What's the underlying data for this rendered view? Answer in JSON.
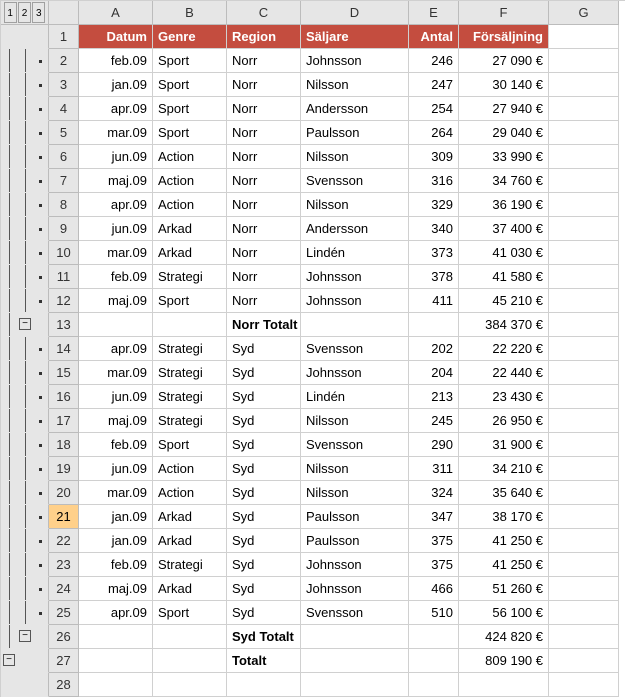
{
  "outline_levels": [
    "1",
    "2",
    "3"
  ],
  "columns": [
    "A",
    "B",
    "C",
    "D",
    "E",
    "F",
    "G"
  ],
  "headers": [
    "Datum",
    "Genre",
    "Region",
    "Säljare",
    "Antal",
    "Försäljning"
  ],
  "rows": [
    {
      "n": 1,
      "header": true
    },
    {
      "n": 2,
      "datum": "feb.09",
      "genre": "Sport",
      "region": "Norr",
      "saljare": "Johnsson",
      "antal": "246",
      "fors": "27 090 €",
      "dot": true,
      "l1": true,
      "l2": true
    },
    {
      "n": 3,
      "datum": "jan.09",
      "genre": "Sport",
      "region": "Norr",
      "saljare": "Nilsson",
      "antal": "247",
      "fors": "30 140 €",
      "dot": true,
      "l1": true,
      "l2": true
    },
    {
      "n": 4,
      "datum": "apr.09",
      "genre": "Sport",
      "region": "Norr",
      "saljare": "Andersson",
      "antal": "254",
      "fors": "27 940 €",
      "dot": true,
      "l1": true,
      "l2": true
    },
    {
      "n": 5,
      "datum": "mar.09",
      "genre": "Sport",
      "region": "Norr",
      "saljare": "Paulsson",
      "antal": "264",
      "fors": "29 040 €",
      "dot": true,
      "l1": true,
      "l2": true
    },
    {
      "n": 6,
      "datum": "jun.09",
      "genre": "Action",
      "region": "Norr",
      "saljare": "Nilsson",
      "antal": "309",
      "fors": "33 990 €",
      "dot": true,
      "l1": true,
      "l2": true
    },
    {
      "n": 7,
      "datum": "maj.09",
      "genre": "Action",
      "region": "Norr",
      "saljare": "Svensson",
      "antal": "316",
      "fors": "34 760 €",
      "dot": true,
      "l1": true,
      "l2": true
    },
    {
      "n": 8,
      "datum": "apr.09",
      "genre": "Action",
      "region": "Norr",
      "saljare": "Nilsson",
      "antal": "329",
      "fors": "36 190 €",
      "dot": true,
      "l1": true,
      "l2": true
    },
    {
      "n": 9,
      "datum": "jun.09",
      "genre": "Arkad",
      "region": "Norr",
      "saljare": "Andersson",
      "antal": "340",
      "fors": "37 400 €",
      "dot": true,
      "l1": true,
      "l2": true
    },
    {
      "n": 10,
      "datum": "mar.09",
      "genre": "Arkad",
      "region": "Norr",
      "saljare": "Lindén",
      "antal": "373",
      "fors": "41 030 €",
      "dot": true,
      "l1": true,
      "l2": true
    },
    {
      "n": 11,
      "datum": "feb.09",
      "genre": "Strategi",
      "region": "Norr",
      "saljare": "Johnsson",
      "antal": "378",
      "fors": "41 580 €",
      "dot": true,
      "l1": true,
      "l2": true
    },
    {
      "n": 12,
      "datum": "maj.09",
      "genre": "Sport",
      "region": "Norr",
      "saljare": "Johnsson",
      "antal": "411",
      "fors": "45 210 €",
      "dot": true,
      "l1": true,
      "l2": true
    },
    {
      "n": 13,
      "subtotal": "Norr Totalt",
      "fors": "384 370 €",
      "minus2": true,
      "l1": true
    },
    {
      "n": 14,
      "datum": "apr.09",
      "genre": "Strategi",
      "region": "Syd",
      "saljare": "Svensson",
      "antal": "202",
      "fors": "22 220 €",
      "dot": true,
      "l1": true,
      "l2": true
    },
    {
      "n": 15,
      "datum": "mar.09",
      "genre": "Strategi",
      "region": "Syd",
      "saljare": "Johnsson",
      "antal": "204",
      "fors": "22 440 €",
      "dot": true,
      "l1": true,
      "l2": true
    },
    {
      "n": 16,
      "datum": "jun.09",
      "genre": "Strategi",
      "region": "Syd",
      "saljare": "Lindén",
      "antal": "213",
      "fors": "23 430 €",
      "dot": true,
      "l1": true,
      "l2": true
    },
    {
      "n": 17,
      "datum": "maj.09",
      "genre": "Strategi",
      "region": "Syd",
      "saljare": "Nilsson",
      "antal": "245",
      "fors": "26 950 €",
      "dot": true,
      "l1": true,
      "l2": true
    },
    {
      "n": 18,
      "datum": "feb.09",
      "genre": "Sport",
      "region": "Syd",
      "saljare": "Svensson",
      "antal": "290",
      "fors": "31 900 €",
      "dot": true,
      "l1": true,
      "l2": true
    },
    {
      "n": 19,
      "datum": "jun.09",
      "genre": "Action",
      "region": "Syd",
      "saljare": "Nilsson",
      "antal": "311",
      "fors": "34 210 €",
      "dot": true,
      "l1": true,
      "l2": true
    },
    {
      "n": 20,
      "datum": "mar.09",
      "genre": "Action",
      "region": "Syd",
      "saljare": "Nilsson",
      "antal": "324",
      "fors": "35 640 €",
      "dot": true,
      "l1": true,
      "l2": true
    },
    {
      "n": 21,
      "datum": "jan.09",
      "genre": "Arkad",
      "region": "Syd",
      "saljare": "Paulsson",
      "antal": "347",
      "fors": "38 170 €",
      "dot": true,
      "l1": true,
      "l2": true,
      "sel": true
    },
    {
      "n": 22,
      "datum": "jan.09",
      "genre": "Arkad",
      "region": "Syd",
      "saljare": "Paulsson",
      "antal": "375",
      "fors": "41 250 €",
      "dot": true,
      "l1": true,
      "l2": true
    },
    {
      "n": 23,
      "datum": "feb.09",
      "genre": "Strategi",
      "region": "Syd",
      "saljare": "Johnsson",
      "antal": "375",
      "fors": "41 250 €",
      "dot": true,
      "l1": true,
      "l2": true
    },
    {
      "n": 24,
      "datum": "maj.09",
      "genre": "Arkad",
      "region": "Syd",
      "saljare": "Johnsson",
      "antal": "466",
      "fors": "51 260 €",
      "dot": true,
      "l1": true,
      "l2": true
    },
    {
      "n": 25,
      "datum": "apr.09",
      "genre": "Sport",
      "region": "Syd",
      "saljare": "Svensson",
      "antal": "510",
      "fors": "56 100 €",
      "dot": true,
      "l1": true,
      "l2": true
    },
    {
      "n": 26,
      "subtotal": "Syd Totalt",
      "fors": "424 820 €",
      "minus2": true,
      "l1": true
    },
    {
      "n": 27,
      "subtotal": "Totalt",
      "fors": "809 190 €",
      "minus1": true
    },
    {
      "n": 28
    }
  ]
}
